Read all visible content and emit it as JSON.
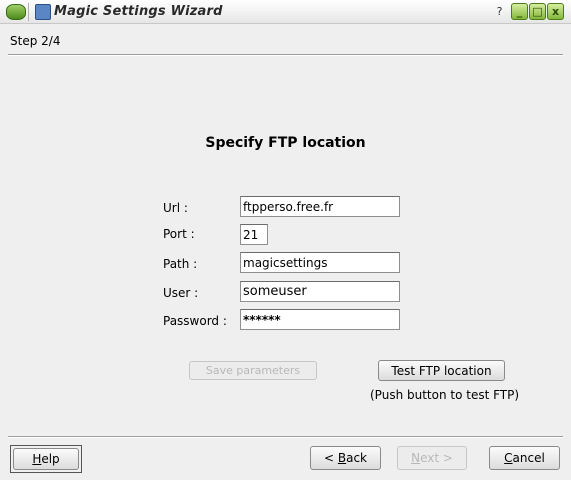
{
  "window": {
    "title": "Magic Settings Wizard",
    "help_glyph": "?",
    "min_glyph": "_",
    "max_glyph": "□",
    "close_glyph": "x"
  },
  "step": "Step 2/4",
  "page_title": "Specify FTP location",
  "form": {
    "url_label": "Url :",
    "url_value": "ftpperso.free.fr",
    "port_label": "Port :",
    "port_value": "21",
    "path_label": "Path :",
    "path_value": "magicsettings",
    "user_label": "User :",
    "user_value": "someuser",
    "password_label": "Password :",
    "password_value": "******"
  },
  "buttons": {
    "save_parameters": "Save parameters",
    "test_ftp": "Test FTP location",
    "help": "Help",
    "help_mnemonic": "H",
    "help_rest": "elp",
    "back_prefix": "< ",
    "back_mnemonic": "B",
    "back_rest": "ack",
    "next_prefix": "",
    "next_mnemonic": "N",
    "next_rest": "ext >",
    "cancel_mnemonic": "C",
    "cancel_rest": "ancel"
  },
  "hint": "(Push button to test FTP)",
  "states": {
    "save_parameters_enabled": false,
    "next_enabled": false
  }
}
